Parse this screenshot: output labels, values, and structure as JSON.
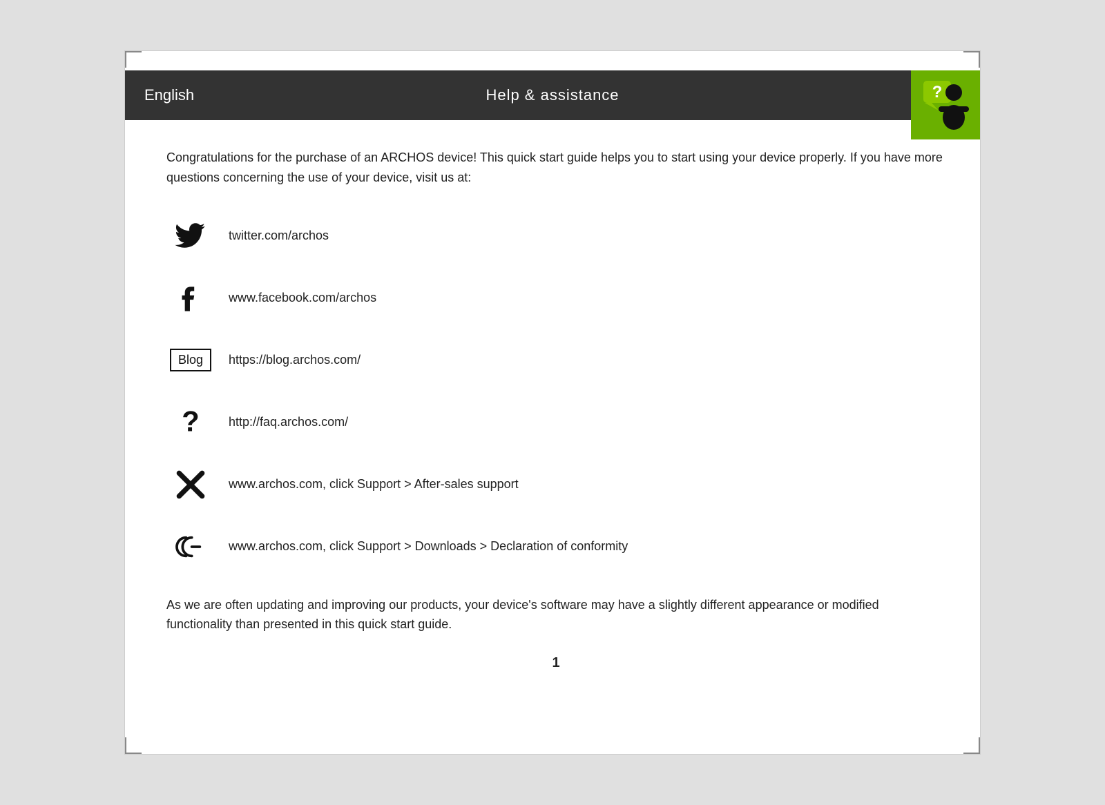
{
  "header": {
    "language": "English",
    "title": "Help & assistance",
    "icon_alt": "help-person-icon"
  },
  "content": {
    "intro": "Congratulations for the purchase of an ARCHOS device! This quick start guide helps you to start using your device properly. If you have more questions concerning the use of your device, visit us at:",
    "links": [
      {
        "id": "twitter",
        "icon_type": "twitter",
        "url": "twitter.com/archos"
      },
      {
        "id": "facebook",
        "icon_type": "facebook",
        "url": "www.facebook.com/archos"
      },
      {
        "id": "blog",
        "icon_type": "blog",
        "url": "https://blog.archos.com/"
      },
      {
        "id": "faq",
        "icon_type": "question",
        "url": "http://faq.archos.com/"
      },
      {
        "id": "support",
        "icon_type": "tools",
        "url": "www.archos.com, click Support > After-sales support"
      },
      {
        "id": "ce",
        "icon_type": "ce",
        "url": "www.archos.com, click Support > Downloads > Declaration of conformity"
      }
    ],
    "footer": "As we are often updating and improving our products, your device's software may have a slightly different appearance or modified functionality than presented in this quick start guide.",
    "page_number": "1"
  }
}
